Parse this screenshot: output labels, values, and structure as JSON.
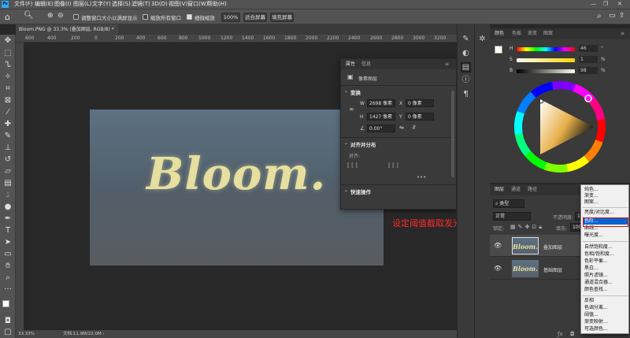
{
  "menubar": {
    "logo": "Ps",
    "items": [
      "文件(F)",
      "编辑(E)",
      "图像(I)",
      "图层(L)",
      "文字(Y)",
      "选择(S)",
      "滤镜(T)",
      "3D(D)",
      "视图(V)",
      "窗口(W)",
      "帮助(H)"
    ]
  },
  "options": {
    "resize_windows": "调整窗口大小以满屏显示",
    "zoom_all": "缩放所有窗口",
    "scrubby_zoom": "细微缩放",
    "zoom_value": "100%",
    "fit_screen": "适合屏幕",
    "fill_screen": "填充屏幕"
  },
  "document": {
    "tab_title": "Bloom.PNG @ 33.3% (叠加图层, RGB/8) *",
    "ruler_ticks": [
      "600",
      "400",
      "200",
      "0",
      "200",
      "400",
      "600",
      "800",
      "1000",
      "1200",
      "1400",
      "1600",
      "1800",
      "2000",
      "2200",
      "2400",
      "2600",
      "2800",
      "3000",
      "3200"
    ],
    "artwork_text": "Bloom.",
    "zoom_status": "33.33%",
    "doc_status": "文档:11.9M/22.0M"
  },
  "properties": {
    "tab_props": "属性",
    "tab_info": "信息",
    "pixel_layer": "像素图层",
    "transform_title": "变换",
    "w_label": "W",
    "w_value": "2698 像素",
    "x_label": "X",
    "x_value": "0 像素",
    "h_label": "H",
    "h_value": "1427 像素",
    "y_label": "Y",
    "y_value": "0 像素",
    "angle_value": "0.00°",
    "align_title": "对齐并分布",
    "align_label": "对齐:",
    "quick_title": "快速操作"
  },
  "annotation": "设定阈值截取发光亮度",
  "color_panel": {
    "tabs": [
      "颜色",
      "色板",
      "渐变",
      "图案"
    ],
    "h_label": "H",
    "h_value": "46",
    "h_unit": "°",
    "s_label": "S",
    "s_value": "1",
    "s_unit": "%",
    "b_label": "B",
    "b_value": "98",
    "b_unit": "%"
  },
  "layers_panel": {
    "tabs": [
      "图层",
      "通道",
      "路径"
    ],
    "kind": "类型",
    "blend_mode": "正常",
    "opacity_label": "不透明度:",
    "opacity_value": "100",
    "lock_label": "锁定:",
    "fill_label": "填充:",
    "fill_value": "100",
    "layers": [
      {
        "name": "叠加图层",
        "thumb": "Bloom."
      },
      {
        "name": "基础图层",
        "thumb": "Bloom."
      }
    ]
  },
  "adjust_menu": {
    "group1": [
      "纯色...",
      "渐变...",
      "图案..."
    ],
    "group2": [
      "亮度/对比度...",
      "色阶...",
      "曲线...",
      "曝光度..."
    ],
    "group3": [
      "自然饱和度...",
      "色相/饱和度...",
      "色彩平衡...",
      "黑白...",
      "照片滤镜...",
      "通道混合器...",
      "颜色查找..."
    ],
    "group4": [
      "反相",
      "色调分离...",
      "阈值...",
      "渐变映射...",
      "可选颜色..."
    ],
    "selected": "色阶..."
  }
}
